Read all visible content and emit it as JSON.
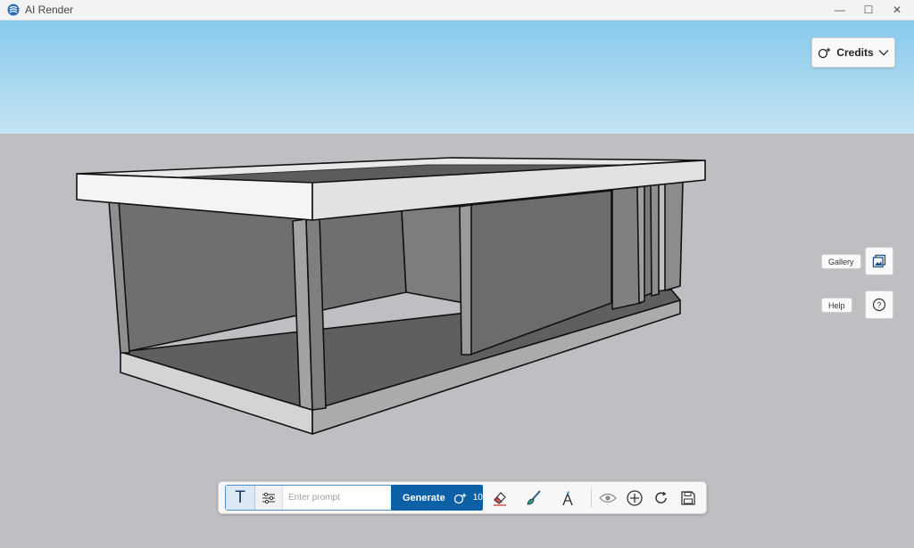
{
  "window": {
    "title": "AI Render",
    "minimize_glyph": "—",
    "maximize_glyph": "☐",
    "close_glyph": "✕"
  },
  "credits": {
    "label": "Credits"
  },
  "side": {
    "gallery_label": "Gallery",
    "help_label": "Help"
  },
  "toolbar": {
    "text_mode_glyph": "T",
    "prompt_placeholder": "Enter prompt",
    "prompt_value": "",
    "generate_label": "Generate",
    "generate_cost": "10"
  },
  "icons": [
    "app-icon",
    "credits-coin-icon",
    "chevron-down-icon",
    "gallery-icon",
    "help-icon",
    "text-mode-icon",
    "sliders-icon",
    "eraser-icon",
    "brush-icon",
    "style-icon",
    "eye-icon",
    "add-icon",
    "redo-icon",
    "save-icon"
  ],
  "colors": {
    "accent": "#0c61a6",
    "sky_top": "#87c9ec",
    "ground": "#bfbec3"
  }
}
